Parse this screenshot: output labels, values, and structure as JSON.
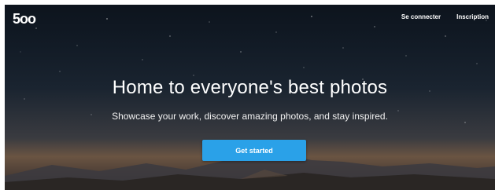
{
  "brand": {
    "logo_text": "5oo"
  },
  "nav": {
    "login_label": "Se connecter",
    "signup_label": "Inscription"
  },
  "hero": {
    "headline": "Home to everyone's best photos",
    "subheadline": "Showcase your work, discover amazing photos, and stay inspired.",
    "cta_label": "Get started"
  },
  "colors": {
    "cta_background": "#2aa1e8",
    "text": "#ffffff",
    "sky_top": "#0d141d",
    "horizon_glow": "#6a5442"
  }
}
